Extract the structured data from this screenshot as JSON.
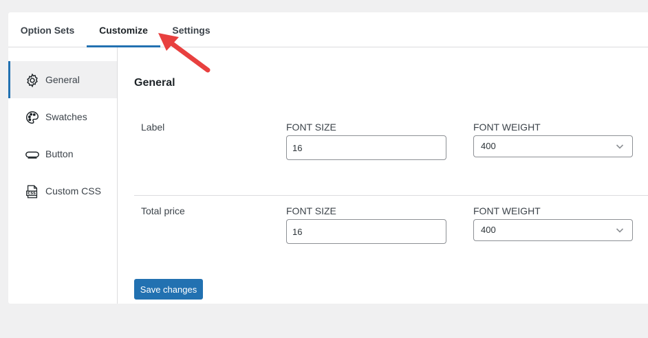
{
  "tabs": [
    {
      "label": "Option Sets",
      "active": false
    },
    {
      "label": "Customize",
      "active": true
    },
    {
      "label": "Settings",
      "active": false
    }
  ],
  "sidebar": {
    "items": [
      {
        "label": "General",
        "icon": "gear-icon",
        "active": true
      },
      {
        "label": "Swatches",
        "icon": "palette-icon",
        "active": false
      },
      {
        "label": "Button",
        "icon": "button-icon",
        "active": false
      },
      {
        "label": "Custom CSS",
        "icon": "css-file-icon",
        "active": false
      }
    ]
  },
  "main": {
    "section_title": "General",
    "rows": [
      {
        "label": "Label",
        "font_size_label": "FONT SIZE",
        "font_size_value": "16",
        "font_weight_label": "FONT WEIGHT",
        "font_weight_value": "400"
      },
      {
        "label": "Total price",
        "font_size_label": "FONT SIZE",
        "font_size_value": "16",
        "font_weight_label": "FONT WEIGHT",
        "font_weight_value": "400"
      }
    ],
    "save_label": "Save changes"
  },
  "colors": {
    "accent": "#2271b1",
    "annotation_arrow": "#e8403f",
    "background": "#f0f0f1"
  }
}
